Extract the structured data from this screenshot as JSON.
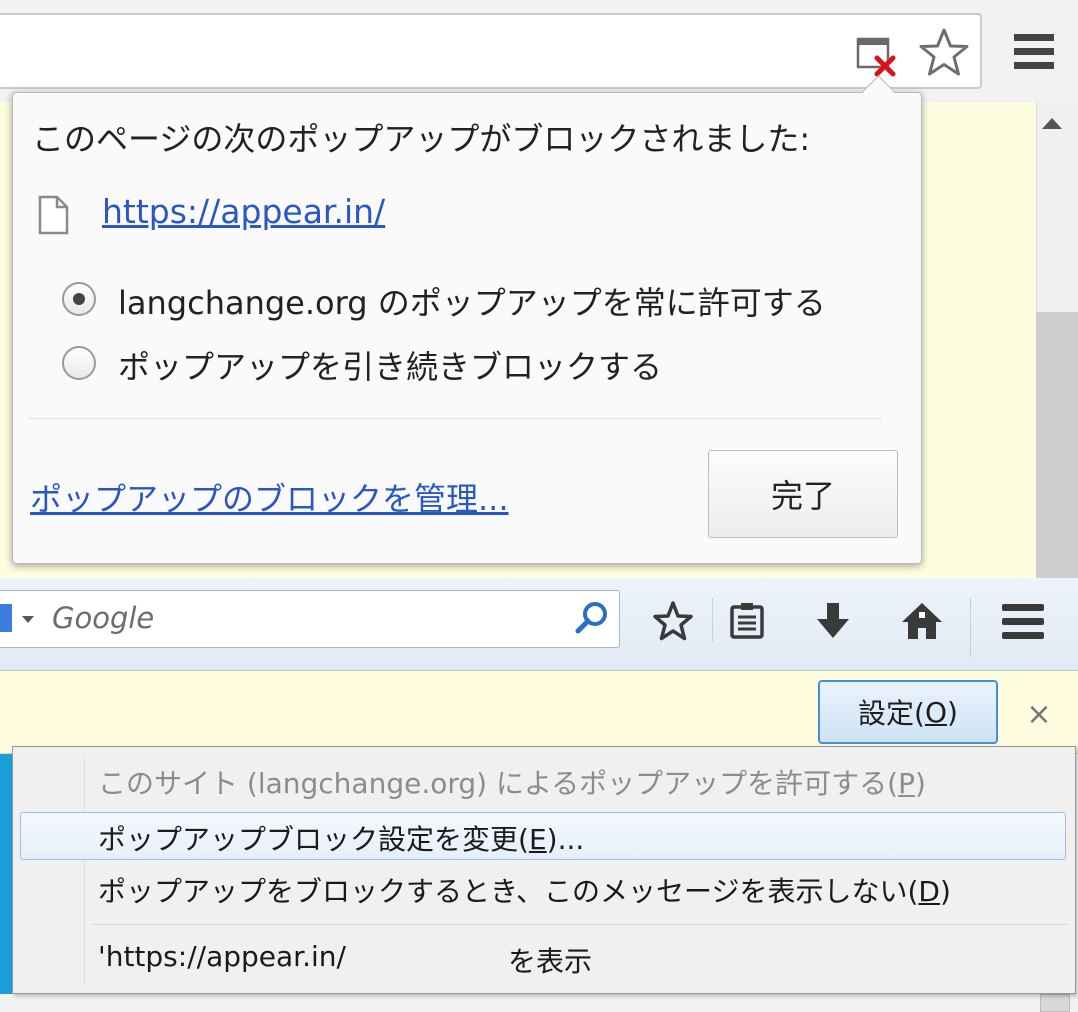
{
  "chrome": {
    "bubble_title": "このページの次のポップアップがブロックされました:",
    "blocked_url": "https://appear.in/",
    "radio_allow_label": "langchange.org のポップアップを常に許可する",
    "radio_block_label": "ポップアップを引き続きブロックする",
    "selected_option": "allow",
    "manage_link": "ポップアップのブロックを管理...",
    "done_button": "完了"
  },
  "firefox": {
    "search_placeholder": "Google",
    "options_button": {
      "text": "設定(",
      "accesskey": "O",
      "suffix": ")"
    },
    "close_symbol": "×",
    "menu": {
      "allow_item": {
        "text": "このサイト (langchange.org) によるポップアップを許可する(",
        "accesskey": "P",
        "suffix": ")"
      },
      "change_item": {
        "text": "ポップアップブロック設定を変更(",
        "accesskey": "E",
        "suffix": ")..."
      },
      "dontshow_item": {
        "text": "ポップアップをブロックするとき、このメッセージを表示しない(",
        "accesskey": "D",
        "suffix": ")"
      },
      "show_item_url": "'https://appear.in/",
      "show_item_suffix": "を表示"
    }
  },
  "colors": {
    "link": "#2a57c8",
    "notification_bar": "#fffce0",
    "accent_blue": "#3f93d6",
    "blocked_x": "#d8141b"
  },
  "icons": [
    "popup-blocked-icon",
    "star-icon",
    "menu-icon",
    "file-icon",
    "search-engine-icon",
    "magnifier-icon",
    "reading-list-icon",
    "download-icon",
    "home-icon",
    "close-icon"
  ]
}
